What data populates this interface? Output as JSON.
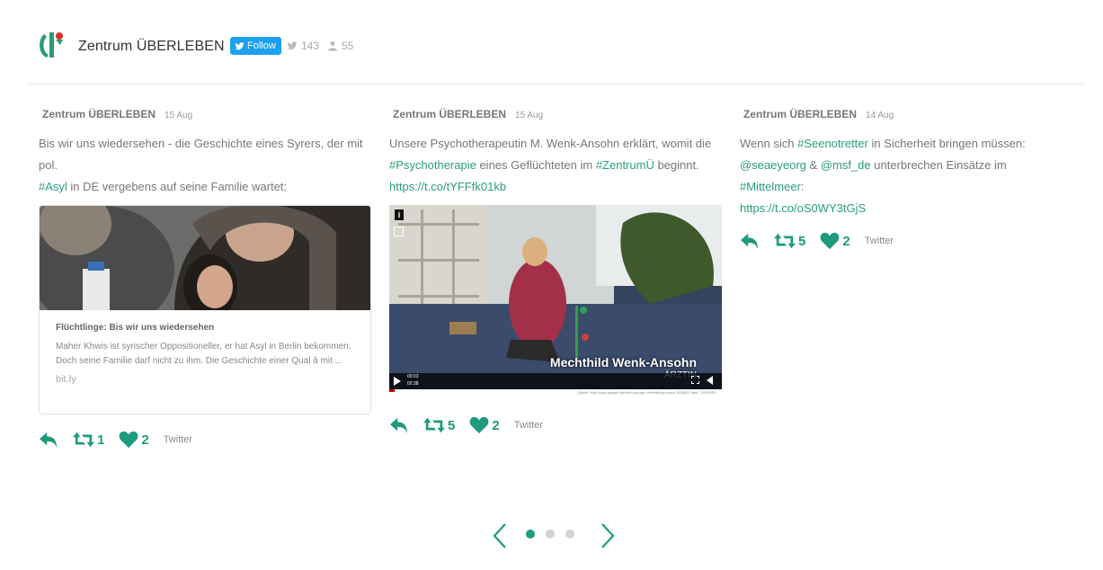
{
  "header": {
    "account_name": "Zentrum ÜBERLEBEN",
    "follow_label": "Follow",
    "tweets_count": "143",
    "followers_count": "55"
  },
  "tweets": [
    {
      "author": "Zentrum ÜBERLEBEN",
      "date": "15 Aug",
      "text_parts": [
        "Bis wir uns wiedersehen - die Geschichte eines Syrers, der mit pol.",
        "#Asyl",
        " in DE vergebens auf seine Familie wartet:"
      ],
      "card": {
        "title": "Flüchtlinge: Bis wir uns wiedersehen",
        "description": "Maher Khwis ist syrischer Oppositioneller, er hat Asyl in Berlin bekommen. Doch seine Familie darf nicht zu ihm. Die Geschichte einer Qual â mit ...",
        "domain": "bit.ly"
      },
      "retweets": "1",
      "likes": "2",
      "source": "Twitter"
    },
    {
      "author": "Zentrum ÜBERLEBEN",
      "date": "15 Aug",
      "text_parts": [
        "Unsere Psychotherapeutin M. Wenk-Ansohn erklärt, womit die",
        "#Psychotherapie",
        " eines Geflüchteten im ",
        "#ZentrumÜ",
        " beginnt.",
        "https://t.co/tYFFfk01kb"
      ],
      "video": {
        "caption_name": "Mechthild Wenk-Ansohn",
        "caption_role": "ÄRZTIN",
        "time_elapsed": "00:03",
        "time_total": "02:38",
        "credit": "Quelle: http://www.spiegel.de/video/traugm-fluechtlinge-video-1665637.html - SPIEGEL"
      },
      "retweets": "5",
      "likes": "2",
      "source": "Twitter"
    },
    {
      "author": "Zentrum ÜBERLEBEN",
      "date": "14 Aug",
      "text_parts": [
        "Wenn sich ",
        "#Seenotretter",
        " in Sicherheit bringen müssen:",
        "@seaeyeorg",
        " & ",
        "@msf_de",
        " unterbrechen Einsätze im ",
        "#Mittelmeer",
        ":",
        "https://t.co/oS0WY3tGjS"
      ],
      "retweets": "5",
      "likes": "2",
      "source": "Twitter"
    }
  ],
  "pager": {
    "pages": 3,
    "active": 1
  },
  "colors": {
    "accent": "#1e9b7e",
    "twitter_blue": "#1da1f2"
  }
}
